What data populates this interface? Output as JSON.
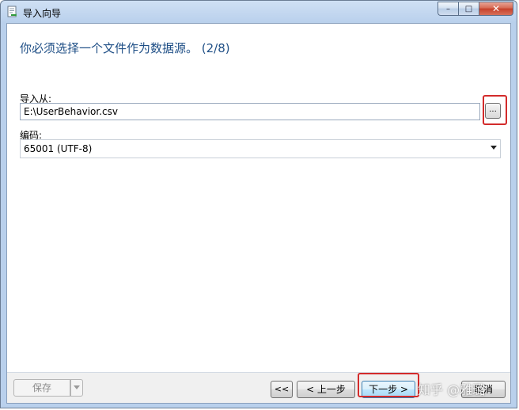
{
  "window": {
    "title": "导入向导",
    "controls": {
      "minimize": "–",
      "maximize": "□",
      "close": "✕"
    }
  },
  "main": {
    "heading": "你必须选择一个文件作为数据源。 (2/8)",
    "import_from_label": "导入从:",
    "import_path_value": "E:\\UserBehavior.csv",
    "browse_label": "...",
    "encoding_label": "编码:",
    "encoding_value": "65001 (UTF-8)"
  },
  "footer": {
    "save_label": "保存",
    "first_label": "<<",
    "prev_label": "< 上一步",
    "next_label": "下一步 >",
    "cancel_label": "取消"
  },
  "watermark": "知乎 @雅璐",
  "colors": {
    "heading": "#1f4f86",
    "highlight": "#d32b2b",
    "titlebar": "#b9d0ec"
  }
}
